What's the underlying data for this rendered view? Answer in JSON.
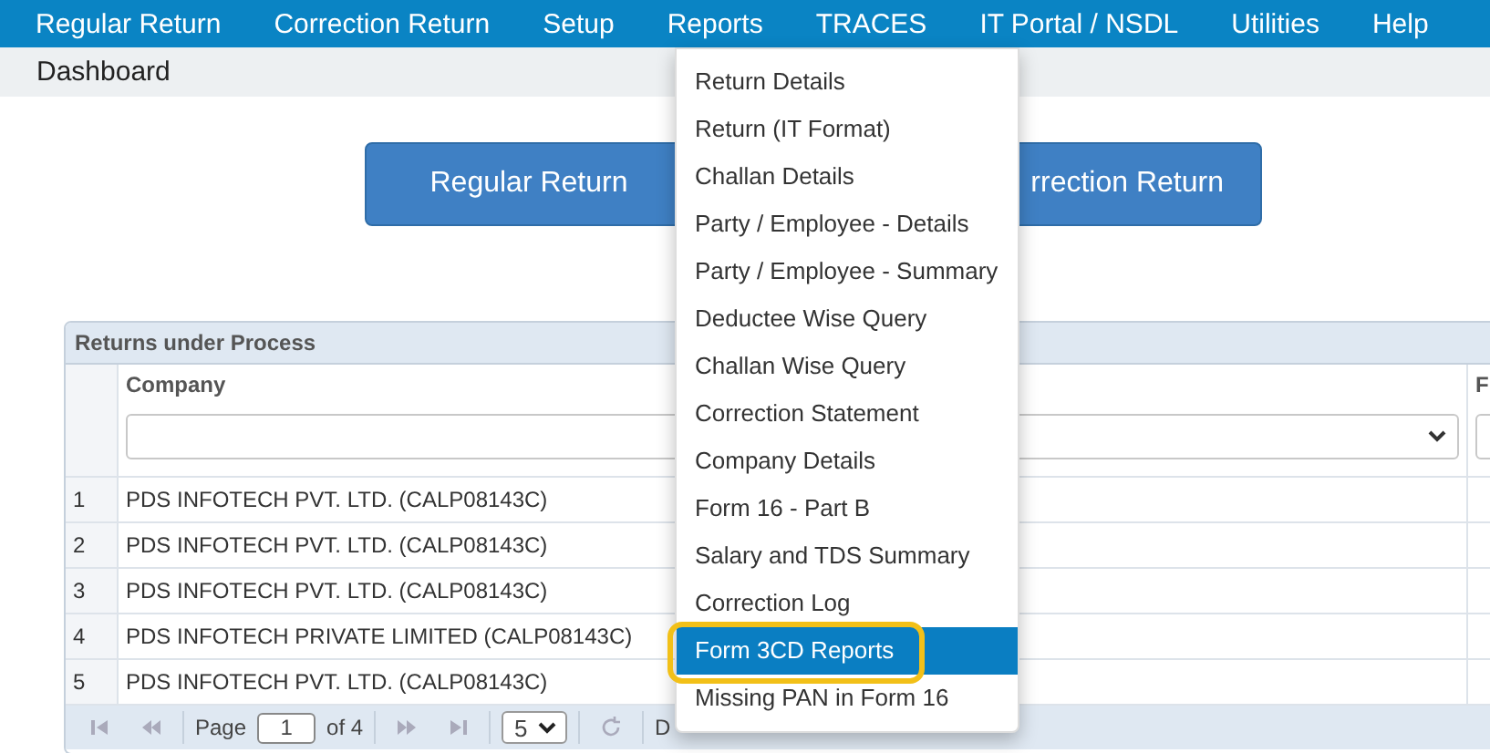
{
  "menu_bar": {
    "items": [
      {
        "label": "Regular Return"
      },
      {
        "label": "Correction Return"
      },
      {
        "label": "Setup"
      },
      {
        "label": "Reports"
      },
      {
        "label": "TRACES"
      },
      {
        "label": "IT Portal / NSDL"
      },
      {
        "label": "Utilities"
      },
      {
        "label": "Help"
      }
    ]
  },
  "breadcrumb": "Dashboard",
  "actions": [
    {
      "label": "Regular Return"
    },
    {
      "label": "rrection Return"
    }
  ],
  "grid": {
    "title": "Returns under Process",
    "columns": [
      "Company",
      "F"
    ],
    "rows": [
      {
        "number": "1",
        "company": "PDS INFOTECH PVT. LTD. (CALP08143C)"
      },
      {
        "number": "2",
        "company": "PDS INFOTECH PVT. LTD. (CALP08143C)"
      },
      {
        "number": "3",
        "company": "PDS INFOTECH PVT. LTD. (CALP08143C)"
      },
      {
        "number": "4",
        "company": "PDS INFOTECH PRIVATE LIMITED (CALP08143C)"
      },
      {
        "number": "5",
        "company": "PDS INFOTECH PVT. LTD. (CALP08143C)"
      }
    ],
    "pager": {
      "page_label": "Page",
      "page": "1",
      "of": "of 4",
      "page_size": "5",
      "status": "D"
    }
  },
  "reports_menu": {
    "items": [
      {
        "label": "Return Details",
        "selected": false,
        "annotated": false
      },
      {
        "label": "Return (IT Format)",
        "selected": false,
        "annotated": false
      },
      {
        "label": "Challan Details",
        "selected": false,
        "annotated": false
      },
      {
        "label": "Party / Employee - Details",
        "selected": false,
        "annotated": false
      },
      {
        "label": "Party / Employee - Summary",
        "selected": false,
        "annotated": false
      },
      {
        "label": "Deductee Wise Query",
        "selected": false,
        "annotated": false
      },
      {
        "label": "Challan Wise Query",
        "selected": false,
        "annotated": false
      },
      {
        "label": "Correction Statement",
        "selected": false,
        "annotated": false
      },
      {
        "label": "Company Details",
        "selected": false,
        "annotated": false
      },
      {
        "label": "Form 16 - Part B",
        "selected": false,
        "annotated": false
      },
      {
        "label": "Salary and TDS Summary",
        "selected": false,
        "annotated": false
      },
      {
        "label": "Correction Log",
        "selected": false,
        "annotated": false
      },
      {
        "label": "Form 3CD Reports",
        "selected": true,
        "annotated": true
      },
      {
        "label": "Missing PAN in Form 16",
        "selected": false,
        "annotated": false
      }
    ]
  }
}
